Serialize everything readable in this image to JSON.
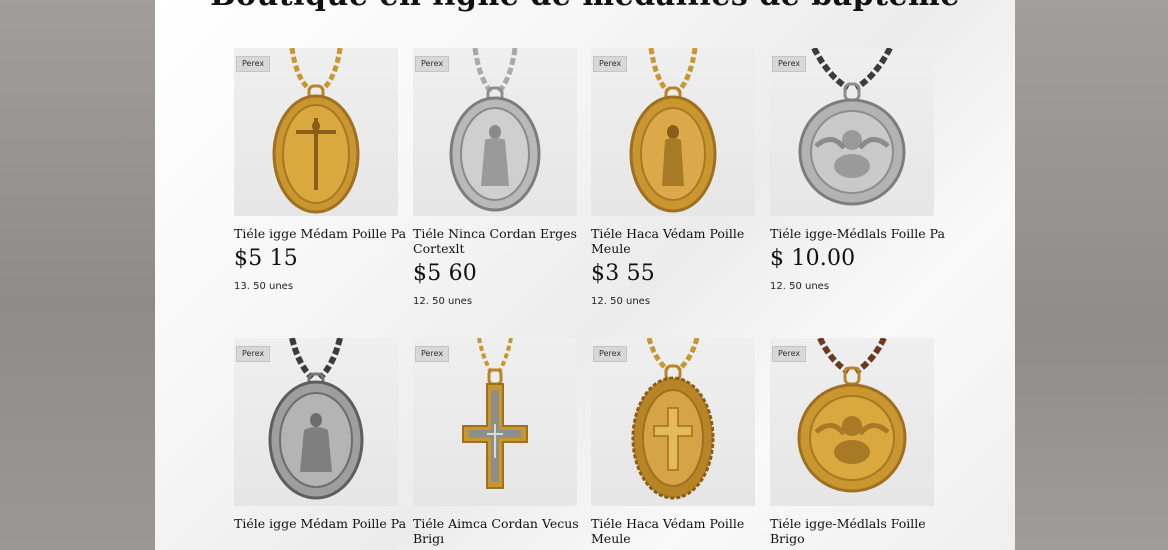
{
  "page": {
    "title": "Boutique en ligne de médailles de baptême"
  },
  "colors": {
    "gold": "#c9962f",
    "silver": "#b9b9b9",
    "chain_dark": "#3c3c3c",
    "chain_brown": "#6b3a1e"
  },
  "products": [
    {
      "badge": "Perex",
      "name": "Tiéle igge Médam Poille Pa",
      "price": "$5 15",
      "sub": "13. 50 unes",
      "icon": "gold-oval-crucifix-medal-icon"
    },
    {
      "badge": "Perex",
      "name": "Tiéle Ninca Cordan Erges Cortexlt",
      "price": "$5 60",
      "sub": "12. 50 unes",
      "icon": "silver-oval-virgin-medal-icon"
    },
    {
      "badge": "Perex",
      "name": "Tiéle Haca Védam Poille Meule",
      "price": "$3 55",
      "sub": "12. 50 unes",
      "icon": "gold-oval-saint-medal-icon"
    },
    {
      "badge": "Perex",
      "name": "Tiéle igge-Médlals Foille Pa",
      "price": "$ 10.00",
      "sub": "12. 50 unes",
      "icon": "silver-round-angel-medal-icon"
    },
    {
      "badge": "Perex",
      "name": "Tiéle igge Médam Poille Pa",
      "price": "",
      "sub": "",
      "icon": "silver-oval-angel-medal-icon"
    },
    {
      "badge": "Perex",
      "name": "Tiéle Aimca Cordan Vecus Brigı",
      "price": "",
      "sub": "",
      "icon": "gold-cross-pendant-icon"
    },
    {
      "badge": "Perex",
      "name": "Tiéle Haca Védam Poille Meule",
      "price": "",
      "sub": "",
      "icon": "gold-oval-cross-medal-icon"
    },
    {
      "badge": "Perex",
      "name": "Tiéle igge-Médlals Foille Brigo",
      "price": "",
      "sub": "",
      "icon": "gold-round-angel-medal-icon"
    }
  ]
}
